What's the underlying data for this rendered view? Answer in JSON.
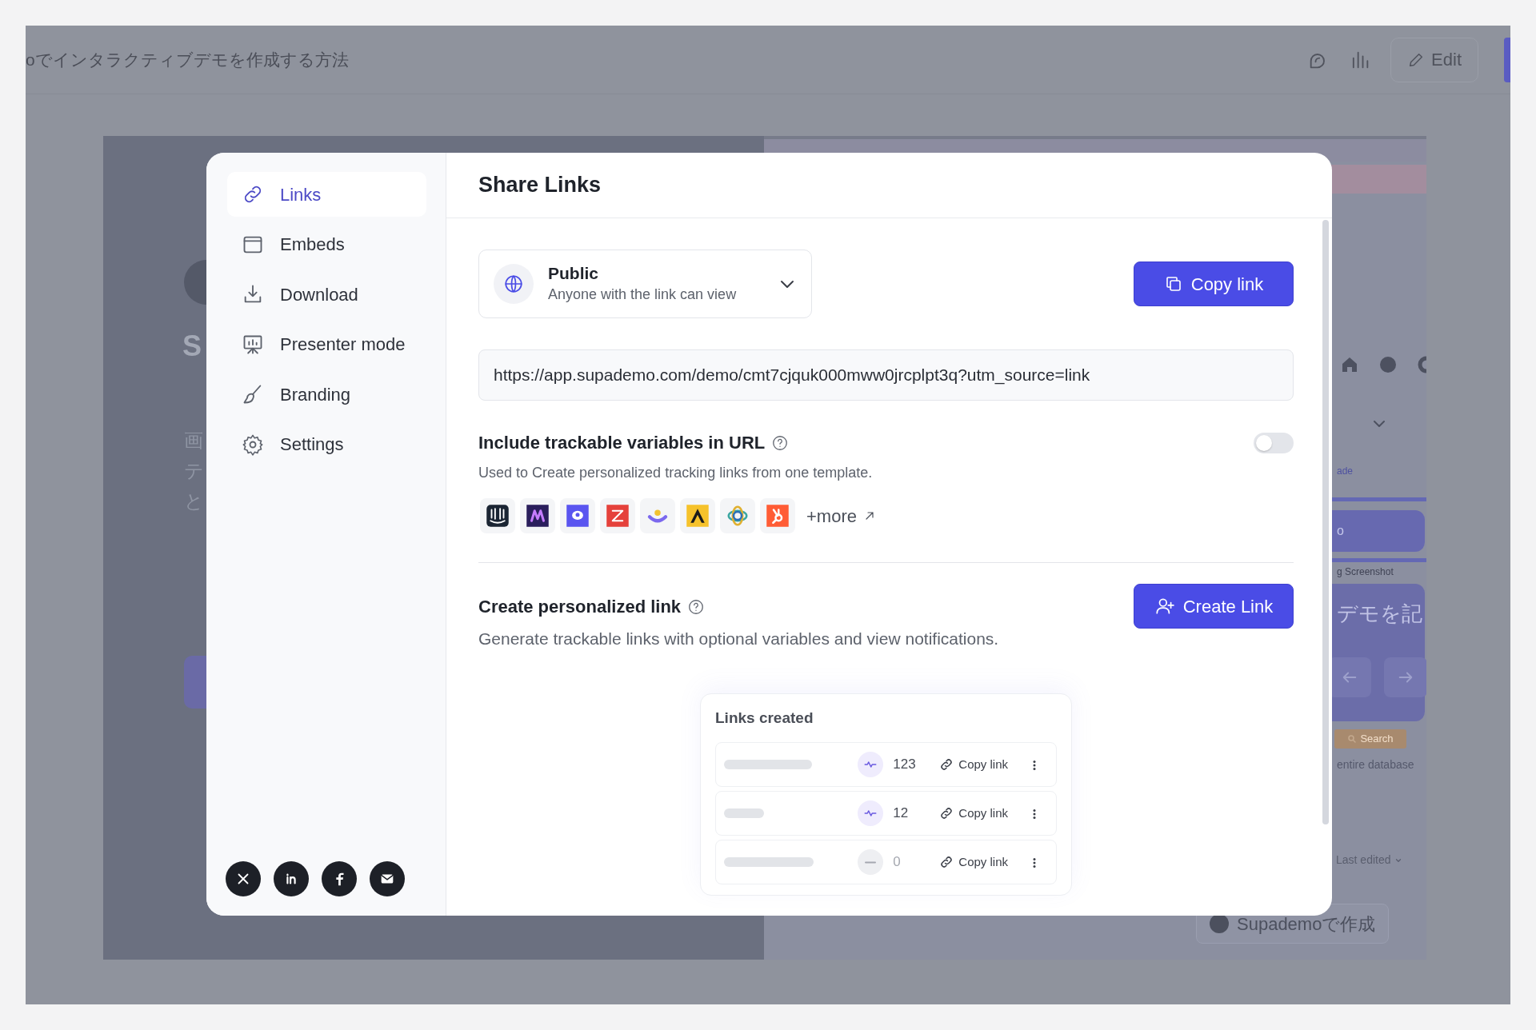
{
  "app_header": {
    "title": "oでインタラクティブデモを作成する方法",
    "edit_button": "Edit"
  },
  "preview_left": {
    "heading_lines": [
      "S"
    ],
    "body_lines": [
      "画",
      "テ",
      "と"
    ]
  },
  "preview_right": {
    "tab_fragment": "ade",
    "button_fragment": "o",
    "label_fragment": "g Screenshot",
    "card_text": "デモを記",
    "search_button": "Search",
    "hint": "entire database",
    "sort_label": "Last edited",
    "made_with": "Supademoで作成"
  },
  "share_modal": {
    "nav": [
      {
        "label": "Links",
        "selected": true
      },
      {
        "label": "Embeds",
        "selected": false
      },
      {
        "label": "Download",
        "selected": false
      },
      {
        "label": "Presenter mode",
        "selected": false
      },
      {
        "label": "Branding",
        "selected": false
      },
      {
        "label": "Settings",
        "selected": false
      }
    ],
    "title": "Share Links",
    "visibility": {
      "label": "Public",
      "description": "Anyone with the link can view"
    },
    "copy_button": "Copy link",
    "url": "https://app.supademo.com/demo/cmt7cjquk000mww0jrcplpt3q?utm_source=link",
    "trackable": {
      "label": "Include trackable variables in URL",
      "on": false,
      "description": "Used to Create personalized tracking links from one template.",
      "more_link": "+more"
    },
    "personalized": {
      "label": "Create personalized link",
      "description": "Generate trackable links with optional variables and view notifications.",
      "button": "Create Link"
    },
    "links_created": {
      "title": "Links created",
      "rows": [
        {
          "views": "123",
          "active": true,
          "copy": "Copy link"
        },
        {
          "views": "12",
          "active": true,
          "copy": "Copy link"
        },
        {
          "views": "0",
          "active": false,
          "copy": "Copy link"
        }
      ]
    }
  }
}
